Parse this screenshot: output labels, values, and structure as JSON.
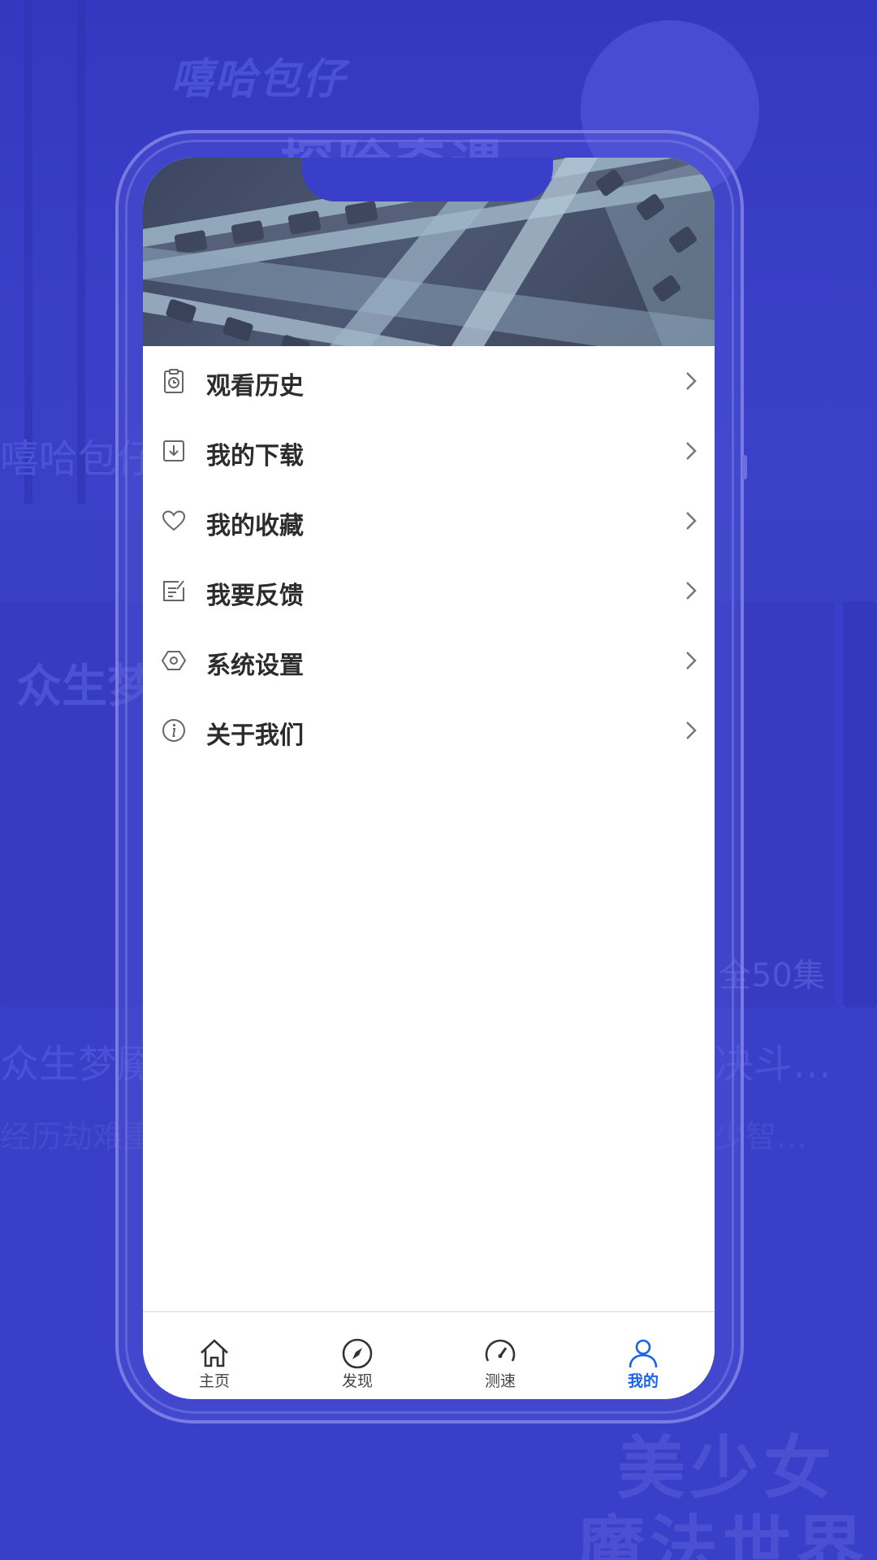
{
  "background": {
    "title_1": "嘻哈包仔",
    "title_2": "探险奇遇",
    "left_label": "嘻哈包仔",
    "card_label": "众生梦魇",
    "card_left_title": "众生梦魇",
    "card_left_sub": "经历劫难重",
    "card_right_title": "决斗…",
    "card_right_sub": "少智…",
    "card_right_episodes": "全50集",
    "bottom_text_1": "美少女",
    "bottom_text_2": "魔法世界"
  },
  "menu": {
    "items": [
      {
        "label": "观看历史",
        "icon": "history-clipboard-icon"
      },
      {
        "label": "我的下载",
        "icon": "download-icon"
      },
      {
        "label": "我的收藏",
        "icon": "heart-icon"
      },
      {
        "label": "我要反馈",
        "icon": "feedback-edit-icon"
      },
      {
        "label": "系统设置",
        "icon": "settings-hexagon-icon"
      },
      {
        "label": "关于我们",
        "icon": "info-icon"
      }
    ]
  },
  "tabbar": {
    "tabs": [
      {
        "label": "主页",
        "icon": "home-icon",
        "active": false
      },
      {
        "label": "发现",
        "icon": "compass-icon",
        "active": false
      },
      {
        "label": "测速",
        "icon": "speedometer-icon",
        "active": false
      },
      {
        "label": "我的",
        "icon": "user-icon",
        "active": true
      }
    ]
  },
  "colors": {
    "background": "#3a3fc9",
    "active_tab": "#1a63e8",
    "menu_text": "#2c2c2c",
    "icon_gray": "#666666"
  }
}
